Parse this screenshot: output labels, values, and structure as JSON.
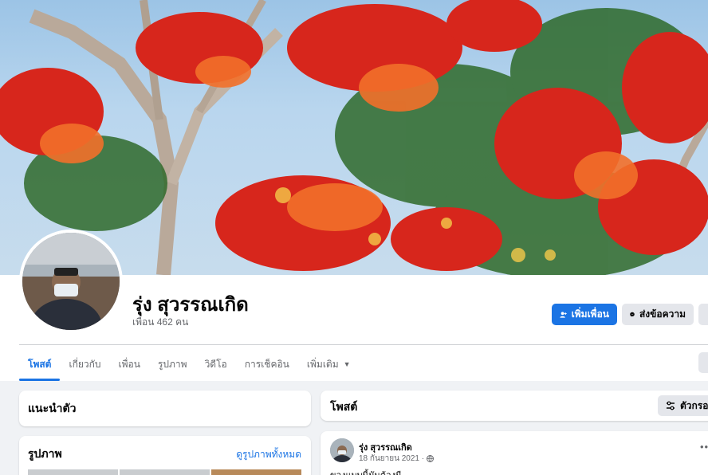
{
  "profile": {
    "name": "รุ่ง สุวรรณเกิด",
    "friends_text": "เพื่อน 462 คน"
  },
  "actions": {
    "add_friend": "เพิ่มเพื่อน",
    "message": "ส่งข้อความ"
  },
  "tabs": [
    {
      "label": "โพสต์",
      "active": true
    },
    {
      "label": "เกี่ยวกับ",
      "active": false
    },
    {
      "label": "เพื่อน",
      "active": false
    },
    {
      "label": "รูปภาพ",
      "active": false
    },
    {
      "label": "วิดีโอ",
      "active": false
    },
    {
      "label": "การเช็คอิน",
      "active": false
    },
    {
      "label": "เพิ่มเติม",
      "active": false
    }
  ],
  "intro": {
    "title": "แนะนำตัว"
  },
  "photos": {
    "title": "รูปภาพ",
    "see_all": "ดูรูปภาพทั้งหมด"
  },
  "posts": {
    "title": "โพสต์",
    "filter_label": "ตัวกรอง"
  },
  "post": {
    "author": "รุ่ง สุวรรณเกิด",
    "date": "18 กันยายน 2021 ·",
    "text": "ของแบบนี้มันต้องมี"
  },
  "colors": {
    "accent": "#1b74e4",
    "background": "#f0f2f5"
  },
  "icons": [
    "add-friend-icon",
    "messenger-icon",
    "caret-down-icon",
    "filter-icon",
    "globe-icon",
    "more-icon"
  ]
}
